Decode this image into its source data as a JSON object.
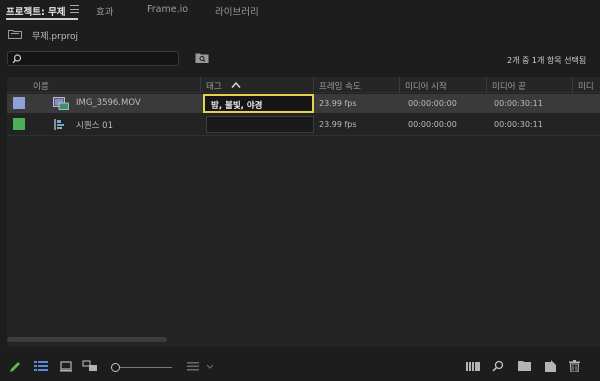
{
  "tabs": [
    {
      "label": "프로젝트: 무제"
    },
    {
      "label": "효과"
    },
    {
      "label": "Frame.io"
    },
    {
      "label": "라이브러리"
    }
  ],
  "project": {
    "file_name": "무제.prproj"
  },
  "search": {
    "value": "",
    "placeholder": ""
  },
  "status_text": "2개 중 1개 항목 선택됨",
  "columns": [
    "이름",
    "태그",
    "프레임 속도",
    "미디어 시작",
    "미디어 끝",
    "미디"
  ],
  "items": [
    {
      "name": "IMG_3596.MOV",
      "tag": "밤, 불빛, 야경",
      "frame_rate": "23.99 fps",
      "media_start": "00:00:00:00",
      "media_end": "00:00:30:11",
      "label_color": "#8da3d6",
      "icon": "video-clip-icon",
      "selected": true,
      "tag_editing": true
    },
    {
      "name": "시퀀스 01",
      "tag": "",
      "frame_rate": "23.99 fps",
      "media_start": "00:00:00:00",
      "media_end": "00:00:30:11",
      "label_color": "#49b055",
      "icon": "sequence-icon",
      "selected": false,
      "tag_editing": false
    }
  ],
  "colors": {
    "accent_edit_border": "#e3d44c",
    "pencil": "#68b45a",
    "list_view": "#5a8bd8"
  },
  "toolbar": {
    "left_icons": [
      "pencil-icon",
      "list-view-icon",
      "icon-view-icon",
      "freeform-view-icon",
      "zoom-slider",
      "sort-icons-icon",
      "chevron-down-icon"
    ],
    "right_icons": [
      "automate-to-sequence-icon",
      "find-icon",
      "new-bin-icon",
      "new-item-icon",
      "trash-icon"
    ]
  }
}
